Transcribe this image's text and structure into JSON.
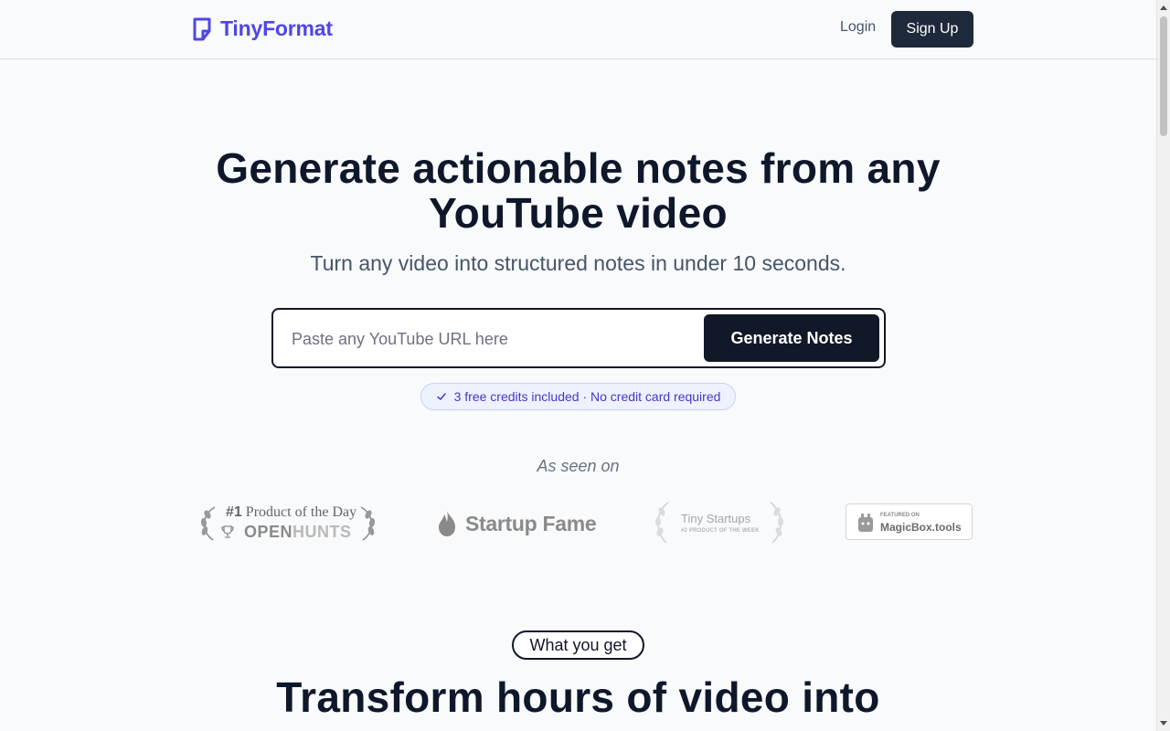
{
  "header": {
    "brand_name": "TinyFormat",
    "brand_icon": "document-icon",
    "brand_color": "#4f46e5",
    "login_label": "Login",
    "signup_label": "Sign Up"
  },
  "hero": {
    "title_line1": "Generate actionable notes from any",
    "title_line2": "YouTube video",
    "subtitle": "Turn any video into structured notes in under 10 seconds.",
    "url_placeholder": "Paste any YouTube URL here",
    "url_value": "",
    "generate_label": "Generate Notes",
    "credits_text": "3 free credits included · No credit card required",
    "credits_icon": "check-icon"
  },
  "seen_on": {
    "label": "As seen on",
    "openhunts": {
      "rank": "#1",
      "line1_rest": "Product of the Day",
      "name_dark": "OPEN",
      "name_light": "HUNTS"
    },
    "startup_fame": {
      "name": "Startup Fame"
    },
    "tiny_startups": {
      "name": "Tiny Startups",
      "award": "#2 PRODUCT OF THE WEEK"
    },
    "magicbox": {
      "featured": "FEATURED ON",
      "name": "MagicBox.tools"
    }
  },
  "features": {
    "badge_label": "What you get",
    "title_line1": "Transform hours of video into"
  }
}
